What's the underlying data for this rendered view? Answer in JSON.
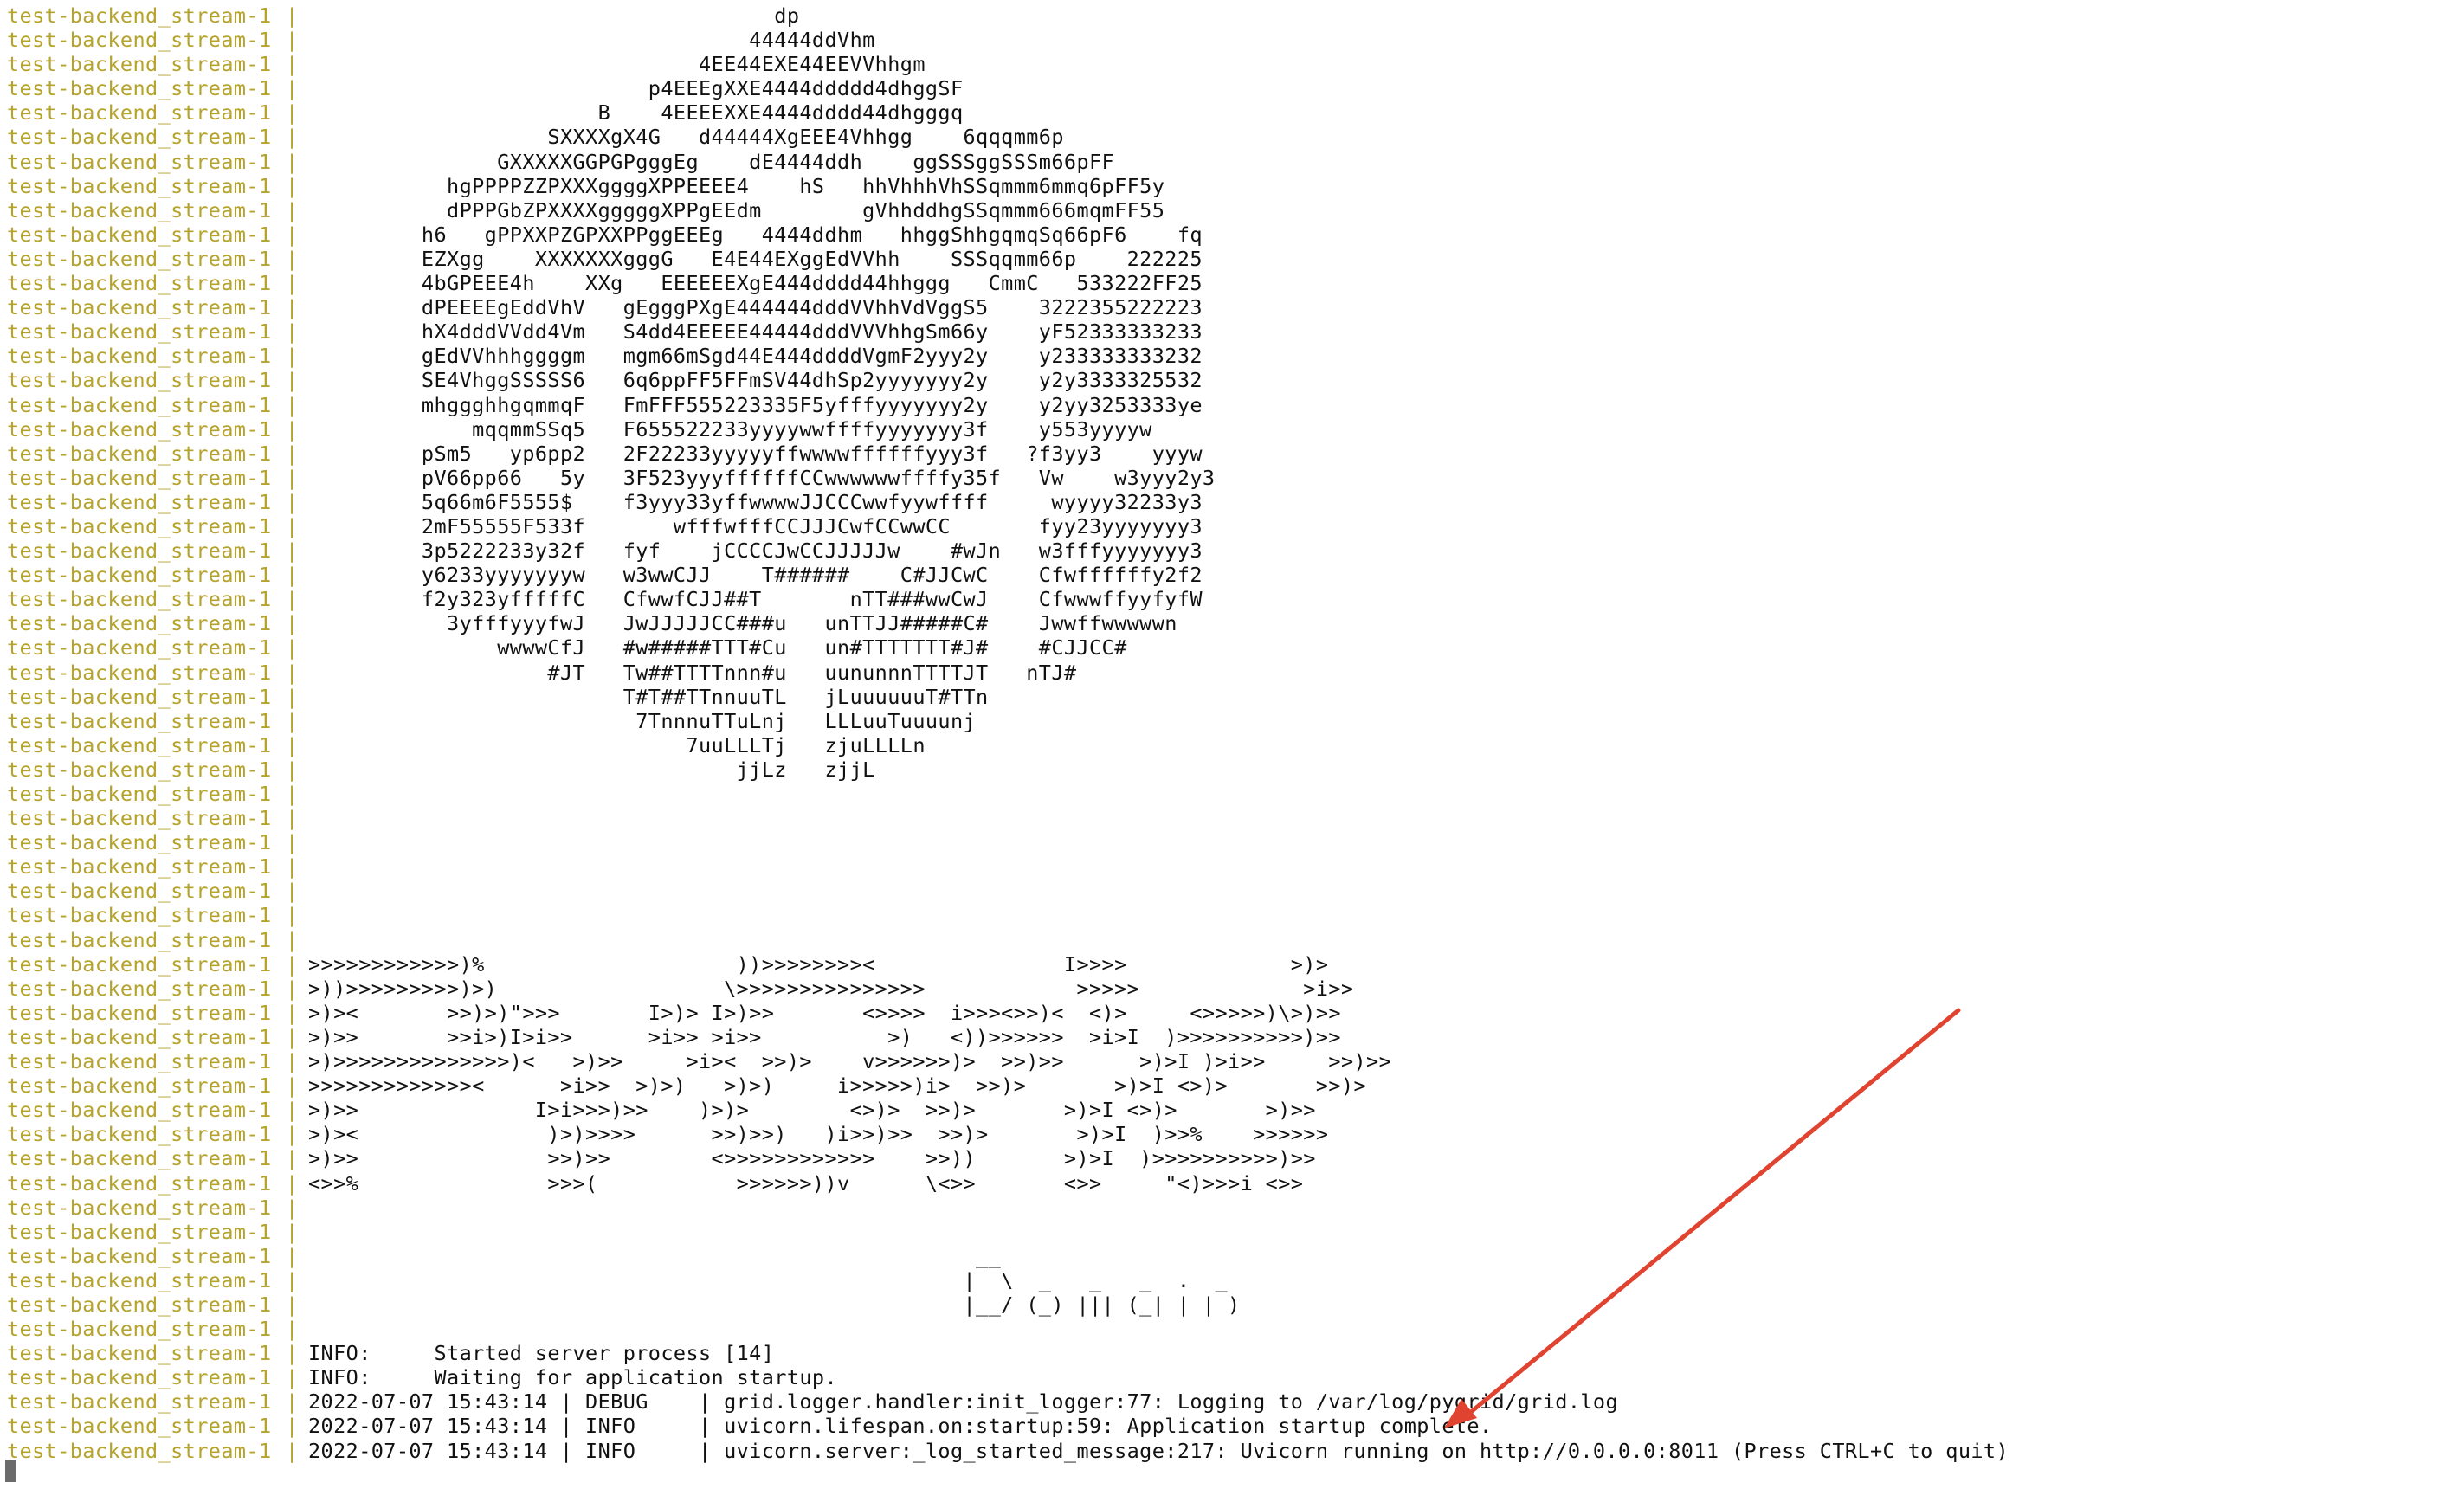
{
  "container_name": "test-backend_stream-1",
  "separator": "|",
  "lines": [
    "                                     dp",
    "                                   44444ddVhm",
    "                               4EE44EXE44EEVVhhgm",
    "                           p4EEEgXXE4444ddddd4dhggSF",
    "                       B    4EEEEXXE4444dddd44dhgggq",
    "                   SXXXXgX4G   d44444XgEEE4Vhhgg    6qqqmm6p",
    "               GXXXXXGGPGPgggEg    dE4444ddh    ggSSSggSSSm66pFF",
    "           hgPPPPZZPXXXggggXPPEEEE4    hS   hhVhhhVhSSqmmm6mmq6pFF5y",
    "           dPPPGbZPXXXXgggggXPPgEEdm        gVhhddhgSSqmmm666mqmFF55",
    "         h6   gPPXXPZGPXXPPggEEEg   4444ddhm   hhggShhgqmqSq66pF6    fq",
    "         EZXgg    XXXXXXXgggG   E4E44EXggEdVVhh    SSSqqmm66p    222225",
    "         4bGPEEE4h    XXg   EEEEEEXgE444dddd44hhggg   CmmC   533222FF25",
    "         dPEEEEgEddVhV   gEgggPXgE444444dddVVhhVdVggS5    3222355222223",
    "         hX4dddVVdd4Vm   S4dd4EEEEE44444dddVVVhhgSm66y    yF52333333233",
    "         gEdVVhhhggggm   mgm66mSgd44E444ddddVgmF2yyy2y    y233333333232",
    "         SE4VhggSSSSS6   6q6ppFF5FFmSV44dhSp2yyyyyyy2y    y2y3333325532",
    "         mhggghhgqmmqF   FmFFF555223335F5yfffyyyyyyy2y    y2yy3253333ye",
    "             mqqmmSSq5   F655522233yyyywwffffyyyyyyy3f    y553yyyyw",
    "         pSm5   yp6pp2   2F22233yyyyyffwwwwffffffyyy3f   ?f3yy3    yyyw",
    "         pV66pp66   5y   3F523yyyffffffCCwwwwwwffffy35f   Vw    w3yyy2y3",
    "         5q66m6F5555$    f3yyy33yffwwwwJJCCCwwfyywffff     wyyyy32233y3",
    "         2mF55555F533f       wfffwfffCCJJJCwfCCwwCC       fyy23yyyyyyy3",
    "         3p5222233y32f   fyf    jCCCCJwCCJJJJJw    #wJn   w3fffyyyyyyy3",
    "         y6233yyyyyyyw   w3wwCJJ    T######    C#JJCwC    Cfwffffffy2f2",
    "         f2y323yfffffC   CfwwfCJJ##T       nTT###wwCwJ    CfwwwffyyfyfW",
    "           3yfffyyyfwJ   JwJJJJJCC###u   unTTJJ#####C#    Jwwffwwwwwn",
    "               wwwwCfJ   #w#####TTT#Cu   un#TTTTTTT#J#    #CJJCC#",
    "                   #JT   Tw##TTTTnnn#u   uununnnTTTTJT   nTJ#",
    "                         T#T##TTnnuuTL   jLuuuuuuT#TTn",
    "                          7TnnnuTTuLnj   LLLuuTuuuunj",
    "                              7uuLLLTj   zjuLLLLn",
    "                                  jjLz   zjjL",
    "",
    "",
    "",
    "",
    "",
    "",
    "",
    ">>>>>>>>>>>>)%                    ))>>>>>>>><               I>>>>             >)>",
    ">))>>>>>>>>>)>)                  \\>>>>>>>>>>>>>>>            >>>>>             >i>>",
    ">)><       >>)>)\">>>       I>)> I>)>>       <>>>>  i>>><>>)<  <)>     <>>>>>)\\>)>>",
    ">)>>       >>i>)I>i>>      >i>> >i>>          >)   <))>>>>>>  >i>I  )>>>>>>>>>>)>>",
    ">)>>>>>>>>>>>>>>)<   >)>>     >i><  >>)>    v>>>>>>)>  >>)>>      >)>I )>i>>     >>)>>",
    ">>>>>>>>>>>>><      >i>>  >)>)   >)>)     i>>>>>)i>  >>)>       >)>I <>)>       >>)>",
    ">)>>              I>i>>>)>>    )>)>        <>)>  >>)>       >)>I <>)>       >)>>",
    ">)><               )>)>>>>      >>)>>)   )i>>)>>  >>)>       >)>I  )>>%    >>>>>>",
    ">)>>               >>)>>        <>>>>>>>>>>>>    >>))       >)>I  )>>>>>>>>>>)>>",
    "<>>%               >>>(           >>>>>>))v      \\<>>       <>>     \"<)>>>i <>>",
    "",
    "",
    "                                                     __",
    "                                                    |  \\  _   _   _  .  _",
    "                                                    |__/ (_) ||| (_| | | )",
    "",
    "INFO:     Started server process [14]",
    "INFO:     Waiting for application startup.",
    "2022-07-07 15:43:14 | DEBUG    | grid.logger.handler:init_logger:77: Logging to /var/log/pygrid/grid.log",
    "2022-07-07 15:43:14 | INFO     | uvicorn.lifespan.on:startup:59: Application startup complete.",
    "2022-07-07 15:43:14 | INFO     | uvicorn.server:_log_started_message:217: Uvicorn running on http://0.0.0.0:8011 (Press CTRL+C to quit)"
  ],
  "colors": {
    "background": "#ffffff",
    "container_name": "#b5a32c",
    "message": "#111111",
    "annotation_arrow": "#e0432f",
    "cursor": "#6b6b6b"
  },
  "annotation": {
    "type": "arrow",
    "points_to": "Application startup complete."
  }
}
